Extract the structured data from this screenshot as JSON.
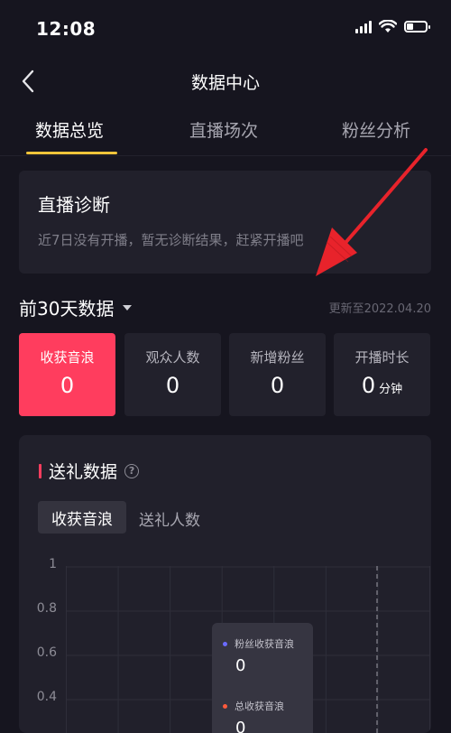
{
  "status_bar": {
    "time": "12:08"
  },
  "nav": {
    "title": "数据中心"
  },
  "tabs": [
    {
      "label": "数据总览",
      "active": true
    },
    {
      "label": "直播场次",
      "active": false
    },
    {
      "label": "粉丝分析",
      "active": false
    }
  ],
  "diagnosis": {
    "title": "直播诊断",
    "text": "近7日没有开播，暂无诊断结果，赶紧开播吧"
  },
  "range": {
    "title": "前30天数据",
    "updated": "更新至2022.04.20"
  },
  "stats": [
    {
      "label": "收获音浪",
      "value": "0",
      "unit": "",
      "active": true
    },
    {
      "label": "观众人数",
      "value": "0",
      "unit": "",
      "active": false
    },
    {
      "label": "新增粉丝",
      "value": "0",
      "unit": "",
      "active": false
    },
    {
      "label": "开播时长",
      "value": "0",
      "unit": "分钟",
      "active": false
    }
  ],
  "gift": {
    "title": "送礼数据",
    "subtabs": [
      {
        "label": "收获音浪",
        "active": true
      },
      {
        "label": "送礼人数",
        "active": false
      }
    ]
  },
  "chart_data": {
    "type": "line",
    "title": "",
    "xlabel": "",
    "ylabel": "",
    "y_ticks": [
      "1",
      "0.8",
      "0.6",
      "0.4"
    ],
    "ylim": [
      0,
      1
    ],
    "grid": true,
    "series": [
      {
        "name": "粉丝收获音浪",
        "color": "#6b6bff"
      },
      {
        "name": "总收获音浪",
        "color": "#ff5a3c"
      }
    ],
    "tooltip": [
      {
        "name": "粉丝收获音浪",
        "value": "0"
      },
      {
        "name": "总收获音浪",
        "value": "0"
      }
    ]
  },
  "colors": {
    "accent": "#ff3d5e",
    "tab_underline": "#f0c43a",
    "arrow": "#e8232b"
  }
}
